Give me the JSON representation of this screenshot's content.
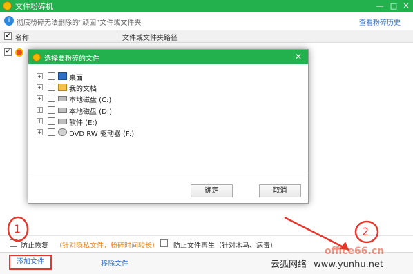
{
  "window": {
    "title": "文件粉碎机",
    "controls": {
      "minimize": "—",
      "maximize": "□",
      "close": "✕"
    }
  },
  "info": {
    "icon": "info-icon",
    "text": "彻底粉碎无法删除的“顽固”文件或文件夹",
    "history_link": "查看粉碎历史"
  },
  "table": {
    "header_check": "✔",
    "col_name": "名称",
    "col_path": "文件或文件夹路径",
    "row1_check": "✔"
  },
  "dialog": {
    "title": "选择要粉碎的文件",
    "close": "✕",
    "tree": [
      {
        "label": "桌面",
        "icon": "desktop-icon"
      },
      {
        "label": "我的文档",
        "icon": "documents-icon"
      },
      {
        "label": "本地磁盘 (C:)",
        "icon": "drive-icon"
      },
      {
        "label": "本地磁盘 (D:)",
        "icon": "drive-icon"
      },
      {
        "label": "软件 (E:)",
        "icon": "drive-icon"
      },
      {
        "label": "DVD RW 驱动器 (F:)",
        "icon": "dvd-drive-icon"
      }
    ],
    "ok": "确定",
    "cancel": "取消"
  },
  "options": {
    "opt1_label": "防止恢复",
    "opt1_hint": "（针对隐私文件，粉碎时间较长）",
    "opt2_label": "防止文件再生（针对木马、病毒）"
  },
  "footer": {
    "add": "添加文件",
    "remove": "移除文件"
  },
  "annotations": {
    "mark1": "1",
    "mark2": "2"
  },
  "watermark": {
    "text_cn": "云狐网络",
    "text_url": "www.yunhu.net",
    "overlay": "office66.cn"
  },
  "colors": {
    "accent_green": "#23b14d",
    "link_blue": "#2f6fc6",
    "annotation_red": "#e4382c",
    "hint_orange": "#e8881c"
  }
}
